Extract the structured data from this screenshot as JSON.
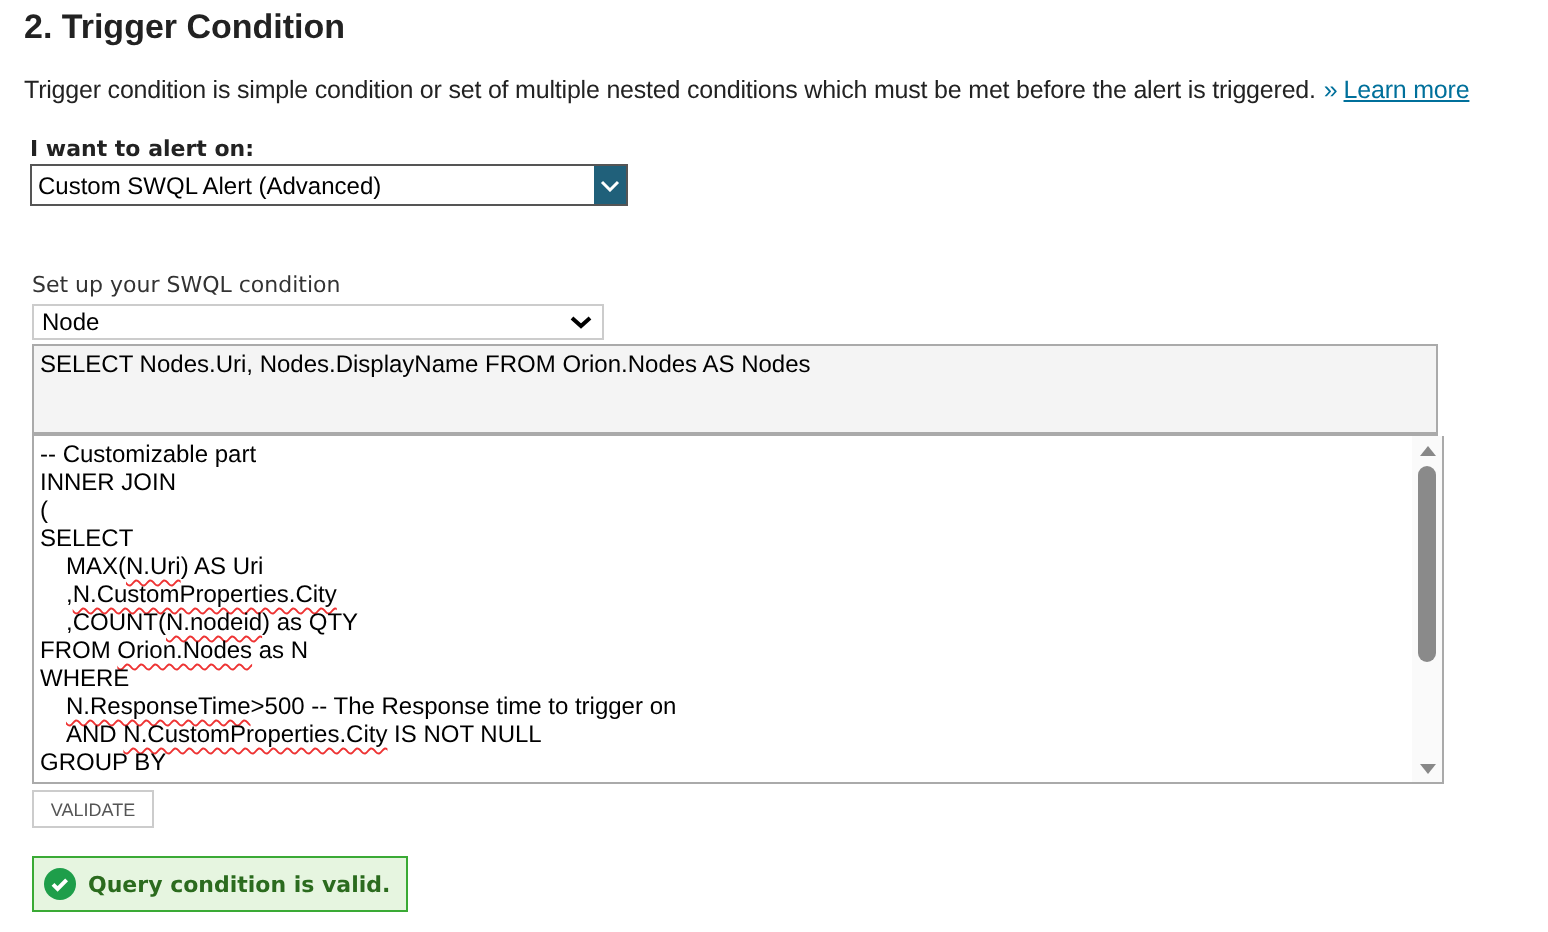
{
  "section": {
    "title": "2. Trigger Condition",
    "description": "Trigger condition is simple condition or set of multiple nested conditions which must be met before the alert is triggered.",
    "link_prefix": "»",
    "link": "Learn more"
  },
  "alert_on": {
    "label": "I want to alert on:",
    "value": "Custom SWQL Alert (Advanced)"
  },
  "swql": {
    "label": "Set up your SWQL condition",
    "object_type": "Node",
    "select_query": "SELECT Nodes.Uri, Nodes.DisplayName FROM Orion.Nodes AS Nodes",
    "custom_lines": [
      {
        "indented": false,
        "segments": [
          {
            "text": "-- Customizable part",
            "flagged": false
          }
        ]
      },
      {
        "indented": false,
        "segments": [
          {
            "text": "INNER JOIN",
            "flagged": false
          }
        ]
      },
      {
        "indented": false,
        "segments": [
          {
            "text": "(",
            "flagged": false
          }
        ]
      },
      {
        "indented": false,
        "segments": [
          {
            "text": "SELECT",
            "flagged": false
          }
        ]
      },
      {
        "indented": true,
        "segments": [
          {
            "text": "MAX(",
            "flagged": false
          },
          {
            "text": "N.Uri",
            "flagged": true
          },
          {
            "text": ") AS Uri",
            "flagged": false
          }
        ]
      },
      {
        "indented": true,
        "segments": [
          {
            "text": ",",
            "flagged": false
          },
          {
            "text": "N.CustomProperties.City",
            "flagged": true
          }
        ]
      },
      {
        "indented": true,
        "segments": [
          {
            "text": ",COUNT(",
            "flagged": false
          },
          {
            "text": "N.nodeid",
            "flagged": true
          },
          {
            "text": ") as QTY",
            "flagged": false
          }
        ]
      },
      {
        "indented": false,
        "segments": [
          {
            "text": "FROM ",
            "flagged": false
          },
          {
            "text": "Orion.Nodes",
            "flagged": true
          },
          {
            "text": " as N",
            "flagged": false
          }
        ]
      },
      {
        "indented": false,
        "segments": [
          {
            "text": "WHERE",
            "flagged": false
          }
        ]
      },
      {
        "indented": true,
        "segments": [
          {
            "text": "N.ResponseTime",
            "flagged": true
          },
          {
            "text": ">500 -- The Response time to trigger on",
            "flagged": false
          }
        ]
      },
      {
        "indented": true,
        "segments": [
          {
            "text": "AND ",
            "flagged": false
          },
          {
            "text": "N.CustomProperties.City",
            "flagged": true
          },
          {
            "text": " IS NOT NULL",
            "flagged": false
          }
        ]
      },
      {
        "indented": false,
        "segments": [
          {
            "text": "GROUP BY",
            "flagged": false
          }
        ]
      }
    ],
    "validate_button": "VALIDATE",
    "result": {
      "kind": "success",
      "message": "Query condition is valid."
    }
  }
}
